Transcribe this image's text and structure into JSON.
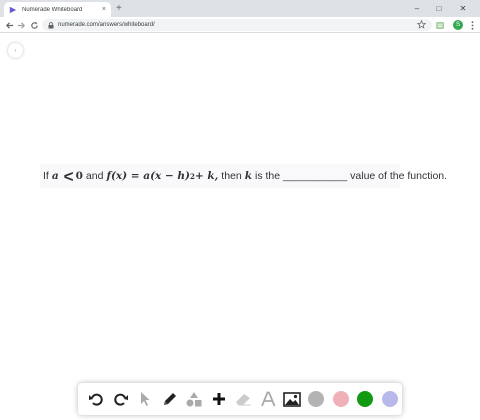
{
  "browser": {
    "tab_title": "Numerade Whiteboard",
    "tab_close": "×",
    "new_tab": "+",
    "url": "numerade.com/answers/whiteboard/",
    "profile_initial": "S",
    "window_controls": [
      "–",
      "□",
      "✕"
    ]
  },
  "question": {
    "p1": "If",
    "a": "a",
    "lt": "<",
    "zero": "0",
    "p2": "and",
    "f_expr": "f(x) = a(x − h)",
    "exp": "2",
    "plus_k": " + k,",
    "p3": "then",
    "k": "k",
    "p4": "is the ___________ value of the function."
  },
  "collapse_icon": "›",
  "toolbar_tools": [
    "undo-icon",
    "redo-icon",
    "pointer-icon",
    "pencil-icon",
    "shapes-icon",
    "plus-icon",
    "eraser-icon",
    "text-icon",
    "image-icon"
  ],
  "colors": {
    "gray": "#b3b3b3",
    "pink": "#f0b0b8",
    "green": "#129a12",
    "lavender": "#b8b8ea",
    "tab_accent": "#6b5bd1"
  }
}
